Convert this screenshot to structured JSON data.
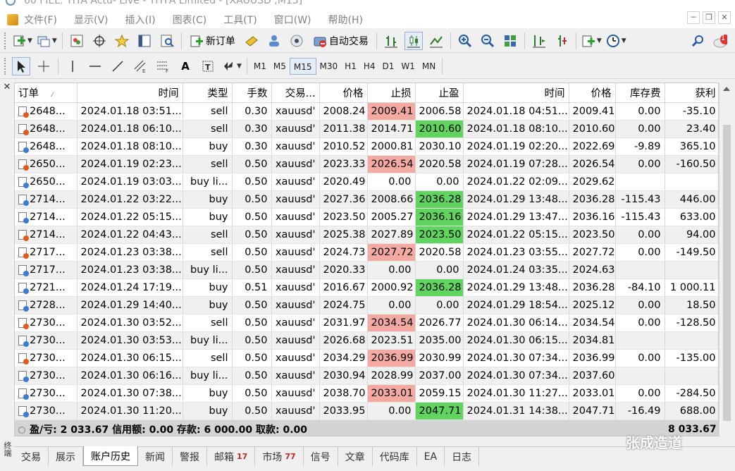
{
  "window": {
    "title": "60 FIEL: TITA Actu- Live - TITFA Limited - [XAUUSD ,M15]"
  },
  "menu": [
    "文件(F)",
    "显示(V)",
    "插入(I)",
    "图表(C)",
    "工具(T)",
    "窗口(W)",
    "帮助(H)"
  ],
  "toolbar": {
    "new_order": "新订单",
    "auto_trading": "自动交易",
    "notification_count": "1"
  },
  "timeframes": [
    "M1",
    "M5",
    "M15",
    "M30",
    "H1",
    "H4",
    "D1",
    "W1",
    "MN"
  ],
  "active_timeframe": "M15",
  "table": {
    "headers": [
      "订单",
      "时间",
      "类型",
      "手数",
      "交易...",
      "价格",
      "止损",
      "止盈",
      "时间",
      "价格",
      "库存费",
      "获利"
    ],
    "rows": [
      {
        "order": "2648...",
        "open_time": "2024.01.18 03:51...",
        "type": "sell",
        "lots": "0.30",
        "symbol": "xauusd'",
        "open_price": "2008.24",
        "sl": "2009.41",
        "tp": "2006.58",
        "close_time": "2024.01.18 04:51...",
        "close_price": "2009.41",
        "swap": "0.00",
        "profit": "-35.10",
        "hl": "sl"
      },
      {
        "order": "2648...",
        "open_time": "2024.01.18 06:10...",
        "type": "sell",
        "lots": "0.30",
        "symbol": "xauusd'",
        "open_price": "2011.38",
        "sl": "2014.71",
        "tp": "2010.60",
        "close_time": "2024.01.18 08:10...",
        "close_price": "2010.60",
        "swap": "0.00",
        "profit": "23.40",
        "hl": "tp"
      },
      {
        "order": "2648...",
        "open_time": "2024.01.18 08:10...",
        "type": "buy",
        "lots": "0.30",
        "symbol": "xauusd'",
        "open_price": "2010.52",
        "sl": "2000.81",
        "tp": "2030.10",
        "close_time": "2024.01.19 02:20...",
        "close_price": "2022.69",
        "swap": "-9.89",
        "profit": "365.10",
        "hl": ""
      },
      {
        "order": "2650...",
        "open_time": "2024.01.19 02:23...",
        "type": "sell",
        "lots": "0.50",
        "symbol": "xauusd'",
        "open_price": "2023.33",
        "sl": "2026.54",
        "tp": "2020.58",
        "close_time": "2024.01.19 07:28...",
        "close_price": "2026.54",
        "swap": "0.00",
        "profit": "-160.50",
        "hl": "sl"
      },
      {
        "order": "2650...",
        "open_time": "2024.01.19 03:03...",
        "type": "buy li...",
        "lots": "0.50",
        "symbol": "xauusd'",
        "open_price": "2020.49",
        "sl": "0.00",
        "tp": "0.00",
        "close_time": "2024.01.22 02:09...",
        "close_price": "2029.62",
        "swap": "",
        "profit": "",
        "hl": ""
      },
      {
        "order": "2714...",
        "open_time": "2024.01.22 03:22...",
        "type": "buy",
        "lots": "0.50",
        "symbol": "xauusd'",
        "open_price": "2027.36",
        "sl": "2008.66",
        "tp": "2036.28",
        "close_time": "2024.01.29 13:48...",
        "close_price": "2036.28",
        "swap": "-115.43",
        "profit": "446.00",
        "hl": "tp"
      },
      {
        "order": "2714...",
        "open_time": "2024.01.22 05:15...",
        "type": "buy",
        "lots": "0.50",
        "symbol": "xauusd'",
        "open_price": "2023.50",
        "sl": "2005.27",
        "tp": "2036.16",
        "close_time": "2024.01.29 13:47...",
        "close_price": "2036.16",
        "swap": "-115.43",
        "profit": "633.00",
        "hl": "tp"
      },
      {
        "order": "2714...",
        "open_time": "2024.01.22 04:43...",
        "type": "sell",
        "lots": "0.50",
        "symbol": "xauusd'",
        "open_price": "2025.38",
        "sl": "2027.89",
        "tp": "2023.50",
        "close_time": "2024.01.22 05:15...",
        "close_price": "2023.50",
        "swap": "0.00",
        "profit": "94.00",
        "hl": "tp"
      },
      {
        "order": "2717...",
        "open_time": "2024.01.23 03:38...",
        "type": "sell",
        "lots": "0.50",
        "symbol": "xauusd'",
        "open_price": "2024.73",
        "sl": "2027.72",
        "tp": "2020.58",
        "close_time": "2024.01.23 03:55...",
        "close_price": "2027.72",
        "swap": "0.00",
        "profit": "-149.50",
        "hl": "sl"
      },
      {
        "order": "2717...",
        "open_time": "2024.01.23 03:38...",
        "type": "buy li...",
        "lots": "0.50",
        "symbol": "xauusd'",
        "open_price": "2020.33",
        "sl": "0.00",
        "tp": "0.00",
        "close_time": "2024.01.24 03:35...",
        "close_price": "2024.63",
        "swap": "",
        "profit": "",
        "hl": ""
      },
      {
        "order": "2721...",
        "open_time": "2024.01.24 17:19...",
        "type": "buy",
        "lots": "0.51",
        "symbol": "xauusd'",
        "open_price": "2016.67",
        "sl": "2000.92",
        "tp": "2036.28",
        "close_time": "2024.01.29 13:48...",
        "close_price": "2036.28",
        "swap": "-84.10",
        "profit": "1 000.11",
        "hl": "tp"
      },
      {
        "order": "2728...",
        "open_time": "2024.01.29 14:40...",
        "type": "buy",
        "lots": "0.50",
        "symbol": "xauusd'",
        "open_price": "2024.75",
        "sl": "0.00",
        "tp": "0.00",
        "close_time": "2024.01.29 18:54...",
        "close_price": "2025.12",
        "swap": "0.00",
        "profit": "18.50",
        "hl": ""
      },
      {
        "order": "2730...",
        "open_time": "2024.01.30 03:52...",
        "type": "sell",
        "lots": "0.50",
        "symbol": "xauusd'",
        "open_price": "2031.97",
        "sl": "2034.54",
        "tp": "2026.77",
        "close_time": "2024.01.30 06:14...",
        "close_price": "2034.54",
        "swap": "0.00",
        "profit": "-128.50",
        "hl": "sl"
      },
      {
        "order": "2730...",
        "open_time": "2024.01.30 03:53...",
        "type": "buy li...",
        "lots": "0.50",
        "symbol": "xauusd'",
        "open_price": "2026.68",
        "sl": "2023.51",
        "tp": "2035.00",
        "close_time": "2024.01.30 06:15...",
        "close_price": "2034.81",
        "swap": "",
        "profit": "",
        "hl": ""
      },
      {
        "order": "2730...",
        "open_time": "2024.01.30 06:15...",
        "type": "sell",
        "lots": "0.50",
        "symbol": "xauusd'",
        "open_price": "2034.29",
        "sl": "2036.99",
        "tp": "2030.99",
        "close_time": "2024.01.30 07:34...",
        "close_price": "2036.99",
        "swap": "0.00",
        "profit": "-135.00",
        "hl": "sl"
      },
      {
        "order": "2730...",
        "open_time": "2024.01.30 06:16...",
        "type": "buy li...",
        "lots": "0.50",
        "symbol": "xauusd'",
        "open_price": "2030.94",
        "sl": "2028.99",
        "tp": "2037.00",
        "close_time": "2024.01.30 07:34...",
        "close_price": "2037.60",
        "swap": "",
        "profit": "",
        "hl": ""
      },
      {
        "order": "2730...",
        "open_time": "2024.01.30 07:38...",
        "type": "buy",
        "lots": "0.50",
        "symbol": "xauusd'",
        "open_price": "2038.70",
        "sl": "2033.01",
        "tp": "2059.15",
        "close_time": "2024.01.30 11:27...",
        "close_price": "2033.01",
        "swap": "0.00",
        "profit": "-284.50",
        "hl": "sl"
      },
      {
        "order": "2730...",
        "open_time": "2024.01.30 11:20...",
        "type": "buy",
        "lots": "0.50",
        "symbol": "xauusd'",
        "open_price": "2033.95",
        "sl": "0.00",
        "tp": "2047.71",
        "close_time": "2024.01.31 14:38...",
        "close_price": "2047.71",
        "swap": "-16.49",
        "profit": "688.00",
        "hl": "tp"
      }
    ],
    "summary": {
      "text": "盈/亏: 2 033.67  信用额: 0.00  存款: 6 000.00  取款: 0.00",
      "total": "8 033.67"
    }
  },
  "side_label": "终端",
  "tabs": [
    {
      "label": "交易",
      "badge": ""
    },
    {
      "label": "展示",
      "badge": ""
    },
    {
      "label": "账户历史",
      "badge": ""
    },
    {
      "label": "新闻",
      "badge": ""
    },
    {
      "label": "警报",
      "badge": ""
    },
    {
      "label": "邮箱",
      "badge": "17"
    },
    {
      "label": "市场",
      "badge": "77"
    },
    {
      "label": "信号",
      "badge": ""
    },
    {
      "label": "文章",
      "badge": ""
    },
    {
      "label": "代码库",
      "badge": ""
    },
    {
      "label": "EA",
      "badge": ""
    },
    {
      "label": "日志",
      "badge": ""
    }
  ],
  "active_tab": "账户历史",
  "watermark": "张成造道",
  "colors": {
    "sl_hit": "#f4a9a3",
    "tp_hit": "#5fd45f",
    "buy_dot": "#3a7bd5",
    "sell_dot": "#e05a20"
  }
}
